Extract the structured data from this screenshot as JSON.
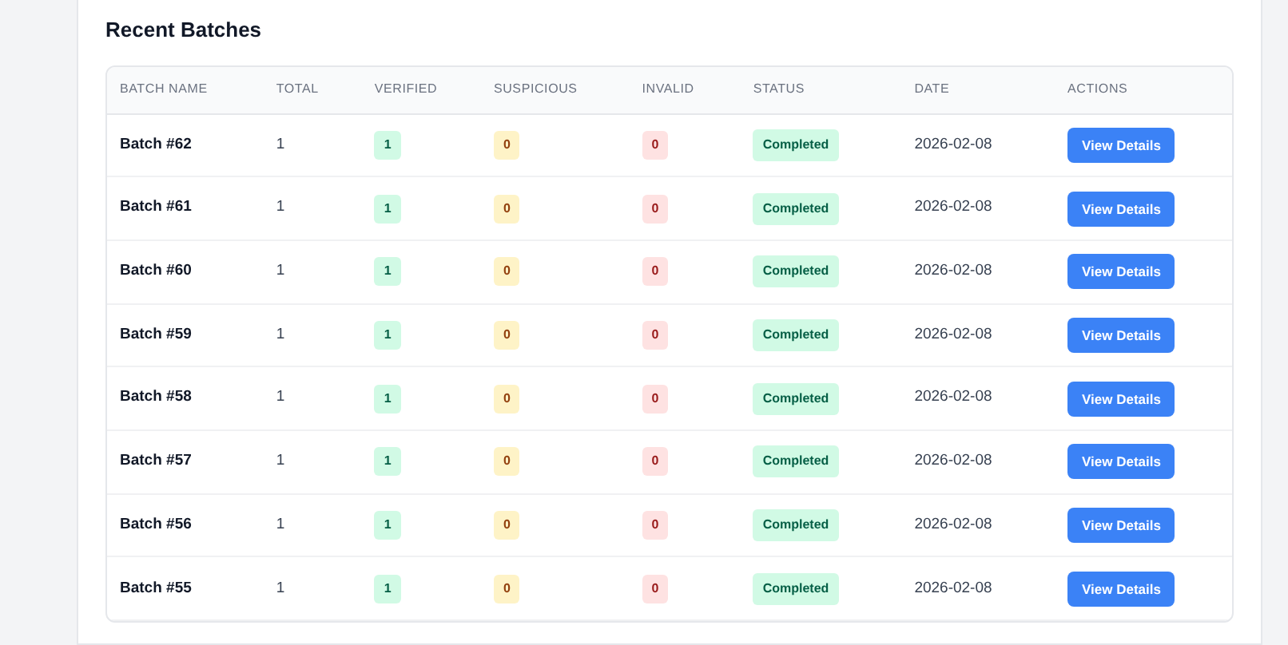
{
  "title": "Recent Batches",
  "table": {
    "columns": [
      "BATCH NAME",
      "TOTAL",
      "VERIFIED",
      "SUSPICIOUS",
      "INVALID",
      "STATUS",
      "DATE",
      "ACTIONS"
    ],
    "rows": [
      {
        "name": "Batch #62",
        "total": "1",
        "verified": "1",
        "suspicious": "0",
        "invalid": "0",
        "status": "Completed",
        "date": "2026-02-08",
        "action": "View Details"
      },
      {
        "name": "Batch #61",
        "total": "1",
        "verified": "1",
        "suspicious": "0",
        "invalid": "0",
        "status": "Completed",
        "date": "2026-02-08",
        "action": "View Details"
      },
      {
        "name": "Batch #60",
        "total": "1",
        "verified": "1",
        "suspicious": "0",
        "invalid": "0",
        "status": "Completed",
        "date": "2026-02-08",
        "action": "View Details"
      },
      {
        "name": "Batch #59",
        "total": "1",
        "verified": "1",
        "suspicious": "0",
        "invalid": "0",
        "status": "Completed",
        "date": "2026-02-08",
        "action": "View Details"
      },
      {
        "name": "Batch #58",
        "total": "1",
        "verified": "1",
        "suspicious": "0",
        "invalid": "0",
        "status": "Completed",
        "date": "2026-02-08",
        "action": "View Details"
      },
      {
        "name": "Batch #57",
        "total": "1",
        "verified": "1",
        "suspicious": "0",
        "invalid": "0",
        "status": "Completed",
        "date": "2026-02-08",
        "action": "View Details"
      },
      {
        "name": "Batch #56",
        "total": "1",
        "verified": "1",
        "suspicious": "0",
        "invalid": "0",
        "status": "Completed",
        "date": "2026-02-08",
        "action": "View Details"
      },
      {
        "name": "Batch #55",
        "total": "1",
        "verified": "1",
        "suspicious": "0",
        "invalid": "0",
        "status": "Completed",
        "date": "2026-02-08",
        "action": "View Details"
      }
    ]
  }
}
